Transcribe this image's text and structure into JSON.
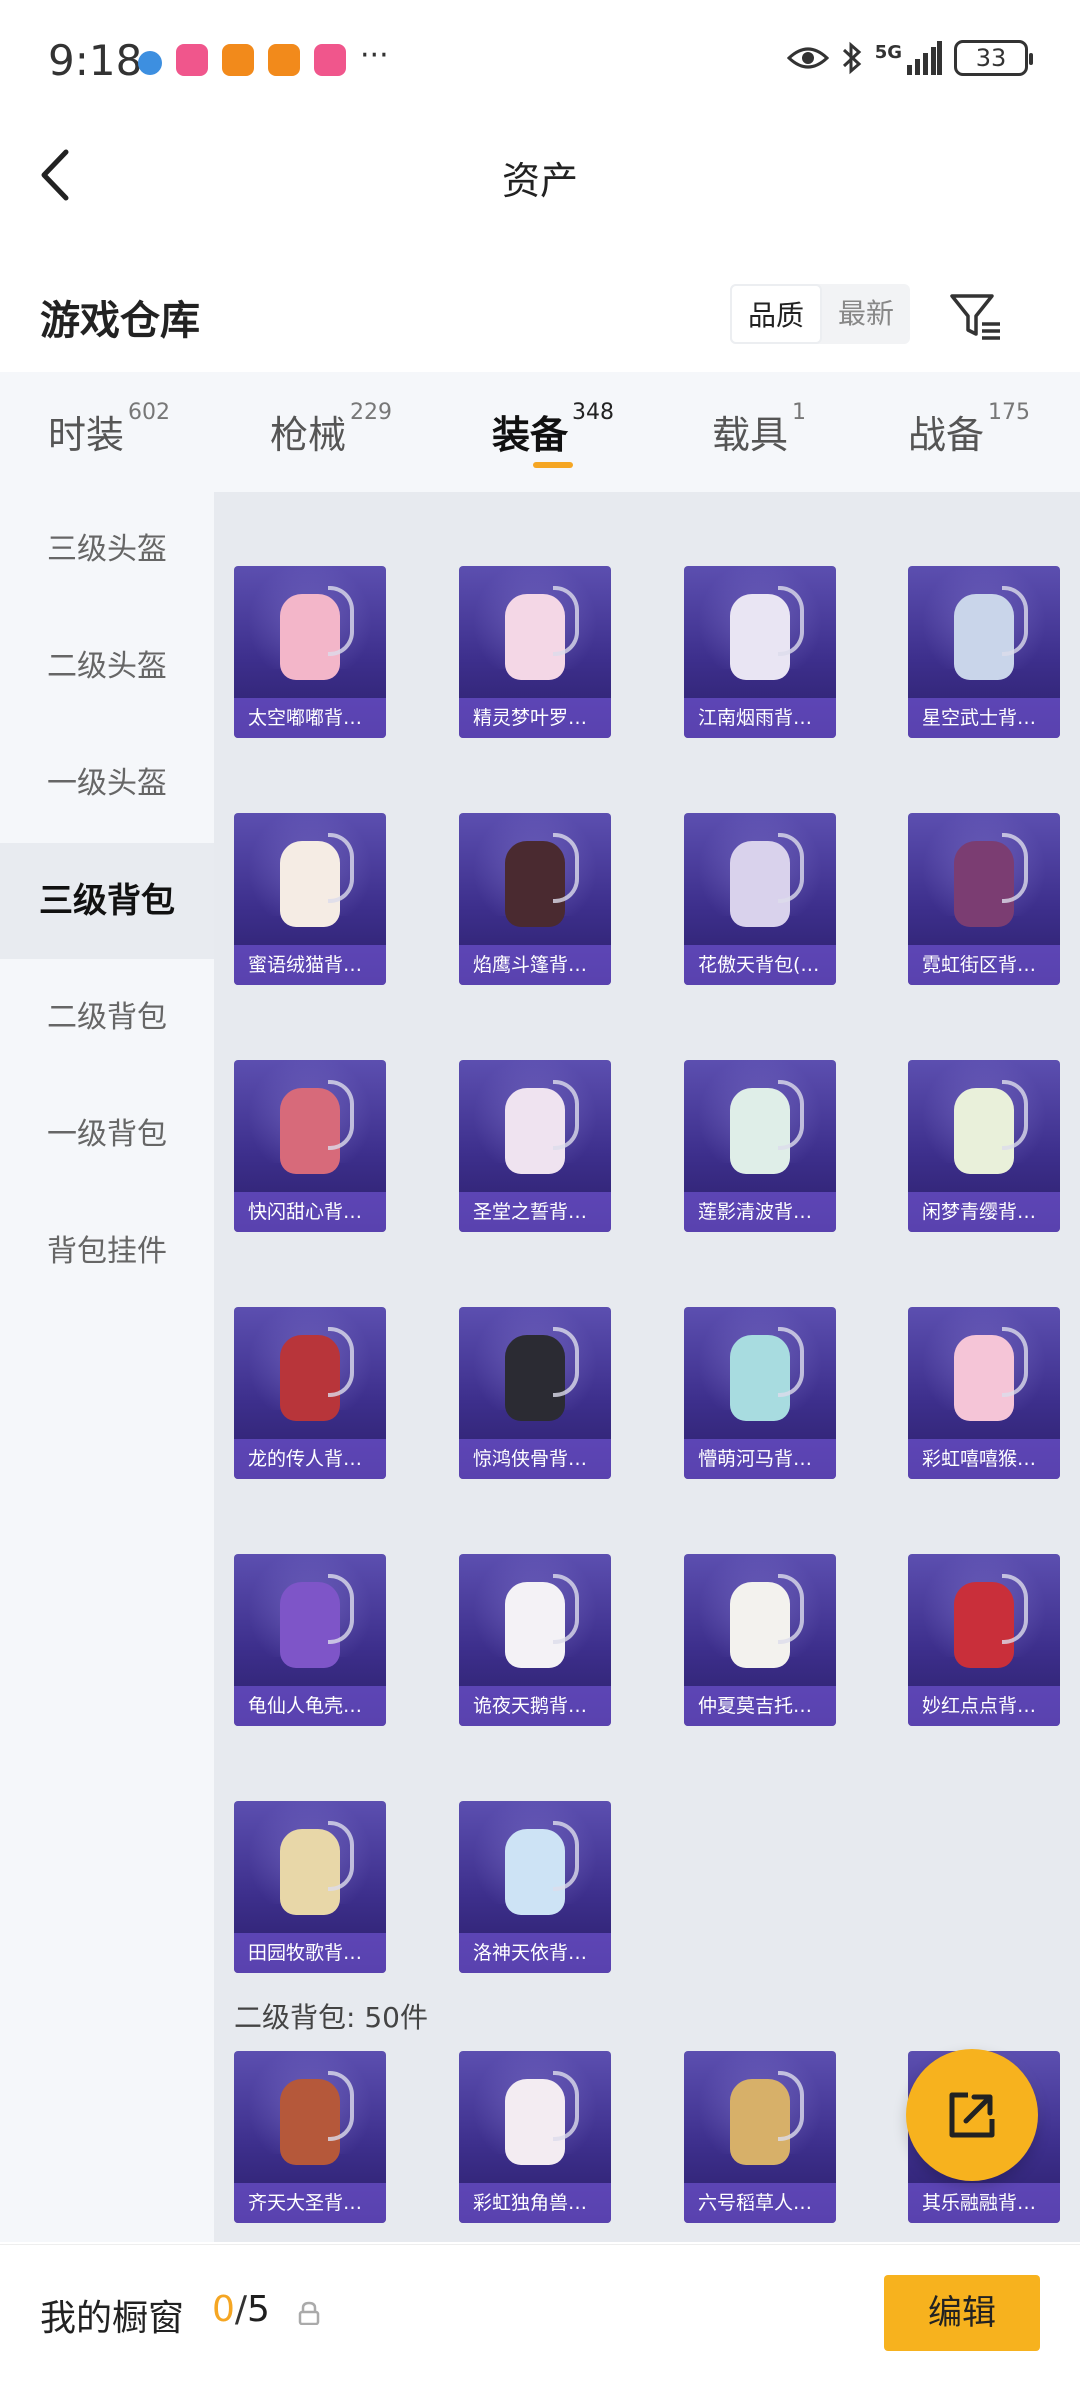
{
  "status_bar": {
    "time": "9:18",
    "network": "5G",
    "battery": "33",
    "icons": [
      "globe-icon",
      "app-icon",
      "app-icon",
      "app-icon",
      "app-icon",
      "more-dots-icon",
      "eye-icon",
      "bluetooth-icon",
      "signal-icon",
      "battery-icon"
    ]
  },
  "header": {
    "title": "资产",
    "back_icon": "chevron-left-icon"
  },
  "warehouse": {
    "title": "游戏仓库",
    "sort_options": [
      "品质",
      "最新"
    ],
    "sort_selected": "品质",
    "filter_icon": "filter-icon"
  },
  "tabs": [
    {
      "label": "时装",
      "count": "602"
    },
    {
      "label": "枪械",
      "count": "229"
    },
    {
      "label": "装备",
      "count": "348",
      "active": true
    },
    {
      "label": "载具",
      "count": "1"
    },
    {
      "label": "战备",
      "count": "175"
    }
  ],
  "sidebar": [
    {
      "label": "三级头盔"
    },
    {
      "label": "二级头盔"
    },
    {
      "label": "一级头盔"
    },
    {
      "label": "三级背包",
      "active": true
    },
    {
      "label": "二级背包"
    },
    {
      "label": "一级背包"
    },
    {
      "label": "背包挂件"
    }
  ],
  "items": [
    "太空嘟嘟背…",
    "精灵梦叶罗…",
    "江南烟雨背…",
    "星空武士背…",
    "蜜语绒猫背…",
    "焰鹰斗篷背…",
    "花傲天背包(…",
    "霓虹街区背…",
    "快闪甜心背…",
    "圣堂之誓背…",
    "莲影清波背…",
    "闲梦青缨背…",
    "龙的传人背…",
    "惊鸿侠骨背…",
    "懵萌河马背…",
    "彩虹嘻嘻猴…",
    "龟仙人龟壳…",
    "诡夜天鹅背…",
    "仲夏莫吉托…",
    "妙红点点背…",
    "田园牧歌背…",
    "洛神天依背…"
  ],
  "section2": {
    "label": "二级背包: 50件",
    "items": [
      "齐天大圣背…",
      "彩虹独角兽…",
      "六号稻草人…",
      "其乐融融背…"
    ]
  },
  "fab_icon": "share-export-icon",
  "bottom_bar": {
    "label": "我的橱窗",
    "current": "0",
    "separator": "/",
    "max": "5",
    "lock_icon": "lock-icon",
    "edit_label": "编辑"
  },
  "colors": {
    "accent": "#f7b21e",
    "highlight": "#f5a623",
    "card_bg": "#3d2f8c"
  }
}
